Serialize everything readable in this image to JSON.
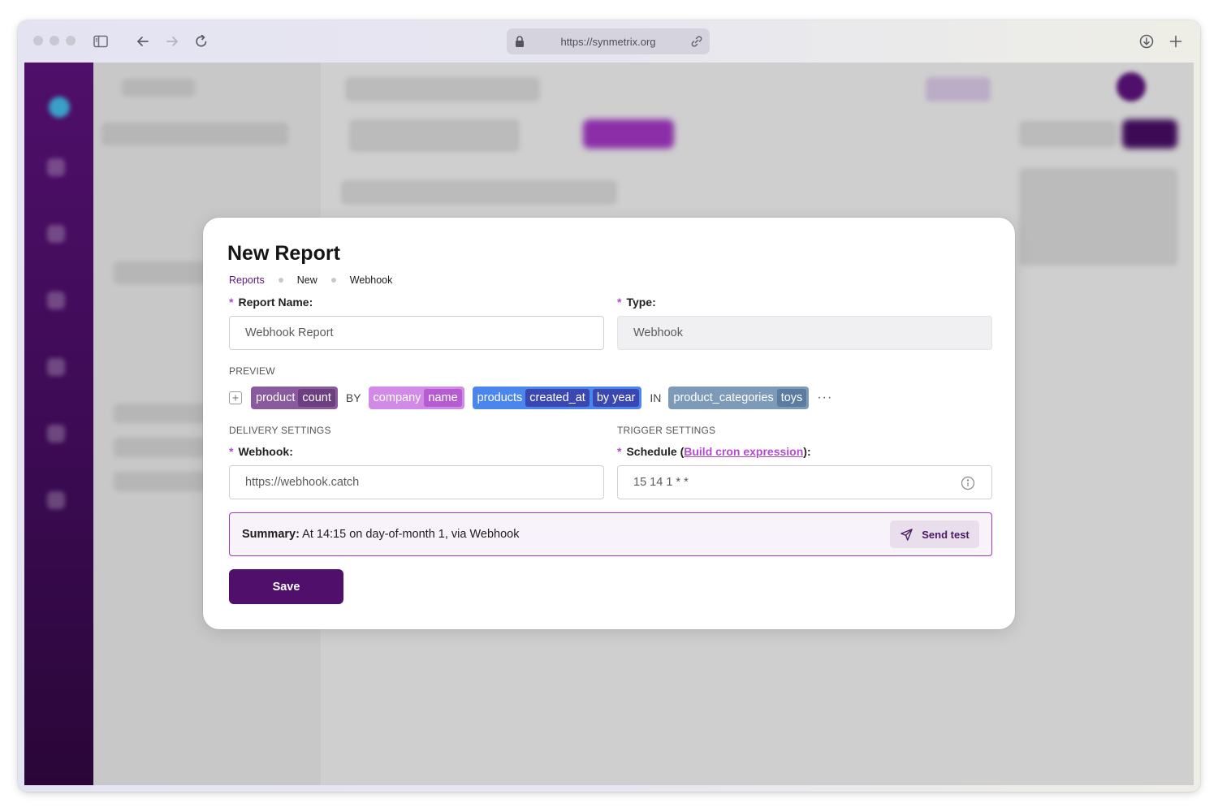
{
  "browser": {
    "url": "https://synmetrix.org"
  },
  "modal": {
    "title": "New Report",
    "breadcrumb": [
      "Reports",
      "New",
      "Webhook"
    ],
    "report_name": {
      "label": "Report Name:",
      "value": "Webhook Report"
    },
    "type": {
      "label": "Type:",
      "value": "Webhook"
    },
    "preview": {
      "section_label": "PREVIEW",
      "chips": [
        {
          "prefix": "product",
          "inner": [
            "count"
          ],
          "color": "#8a5a9e",
          "inner_color": "#6b3f80"
        },
        {
          "keyword": "BY"
        },
        {
          "prefix": "company",
          "inner": [
            "name"
          ],
          "color": "#d18ae6",
          "inner_color": "#b45cd0"
        },
        {
          "prefix": "products",
          "inner": [
            "created_at",
            "by year"
          ],
          "color": "#4a86ee",
          "inner_color": "#3a47b0"
        },
        {
          "keyword": "IN"
        },
        {
          "prefix": "product_categories",
          "inner": [
            "toys"
          ],
          "color": "#7d9ab9",
          "inner_color": "#5b7ca0"
        }
      ],
      "more": "···"
    },
    "delivery": {
      "section_label": "DELIVERY SETTINGS",
      "webhook_label": "Webhook:",
      "webhook_value": "https://webhook.catch"
    },
    "trigger": {
      "section_label": "TRIGGER SETTINGS",
      "schedule_label_prefix": "Schedule (",
      "schedule_link": "Build cron expression",
      "schedule_label_suffix": "):",
      "schedule_value": "15 14 1 * *"
    },
    "summary": {
      "label": "Summary:",
      "text": " At 14:15 on day-of-month 1, via Webhook",
      "send_test": "Send test"
    },
    "save_label": "Save"
  },
  "colors": {
    "accent": "#4f0f6a",
    "required_star": "#b24bd1"
  }
}
